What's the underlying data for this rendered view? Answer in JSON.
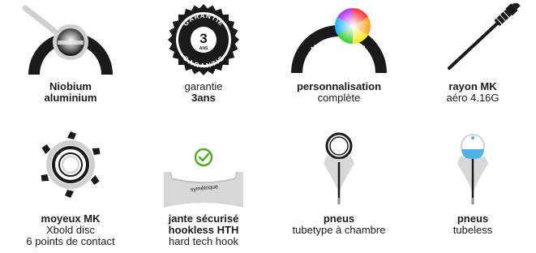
{
  "features": [
    {
      "id": "niobium",
      "icon": "rim-cross-section-icon",
      "lines": [
        {
          "text": "Niobium",
          "bold": true
        },
        {
          "text": "aluminium",
          "bold": true
        }
      ]
    },
    {
      "id": "garantie",
      "icon": "warranty-seal-icon",
      "seal_top": "GARANTIE",
      "seal_number": "3",
      "seal_sub": "ANS",
      "seal_bottom": "GARANTIE",
      "lines": [
        {
          "text": "garantie",
          "bold": false
        },
        {
          "text": "3ans",
          "bold": true
        }
      ]
    },
    {
      "id": "personnalisation",
      "icon": "color-wheel-rim-icon",
      "rim_text": "MAKADAM",
      "lines": [
        {
          "text": "personnalisation",
          "bold": true
        },
        {
          "text": "complète",
          "bold": false
        }
      ]
    },
    {
      "id": "rayon",
      "icon": "spoke-icon",
      "lines": [
        {
          "text": "rayon MK",
          "bold": true
        },
        {
          "text": "aéro 4.16G",
          "bold": false
        }
      ]
    },
    {
      "id": "moyeux",
      "icon": "hub-icon",
      "lines": [
        {
          "text": "moyeux MK",
          "bold": true
        },
        {
          "text": "Xbold disc",
          "bold": false
        },
        {
          "text": "6 points de contact",
          "bold": false
        }
      ]
    },
    {
      "id": "jante",
      "icon": "symmetric-rim-icon",
      "rim_label": "symétrique",
      "lines": [
        {
          "text": "jante sécurisé",
          "bold": true
        },
        {
          "text": "hookless HTH",
          "bold": true
        },
        {
          "text": "hard tech hook",
          "bold": false
        }
      ]
    },
    {
      "id": "pneus-tubetype",
      "icon": "tubetype-tire-icon",
      "lines": [
        {
          "text": "pneus",
          "bold": true
        },
        {
          "text": "tubetype à chambre",
          "bold": false
        }
      ]
    },
    {
      "id": "pneus-tubeless",
      "icon": "tubeless-tire-icon",
      "lines": [
        {
          "text": "pneus",
          "bold": true
        },
        {
          "text": "tubeless",
          "bold": false
        }
      ]
    }
  ],
  "colors": {
    "dark": "#1a1a1a",
    "grey": "#cfcfcf",
    "check_green": "#4caf1a",
    "sealant_blue": "#4fb3e8"
  }
}
